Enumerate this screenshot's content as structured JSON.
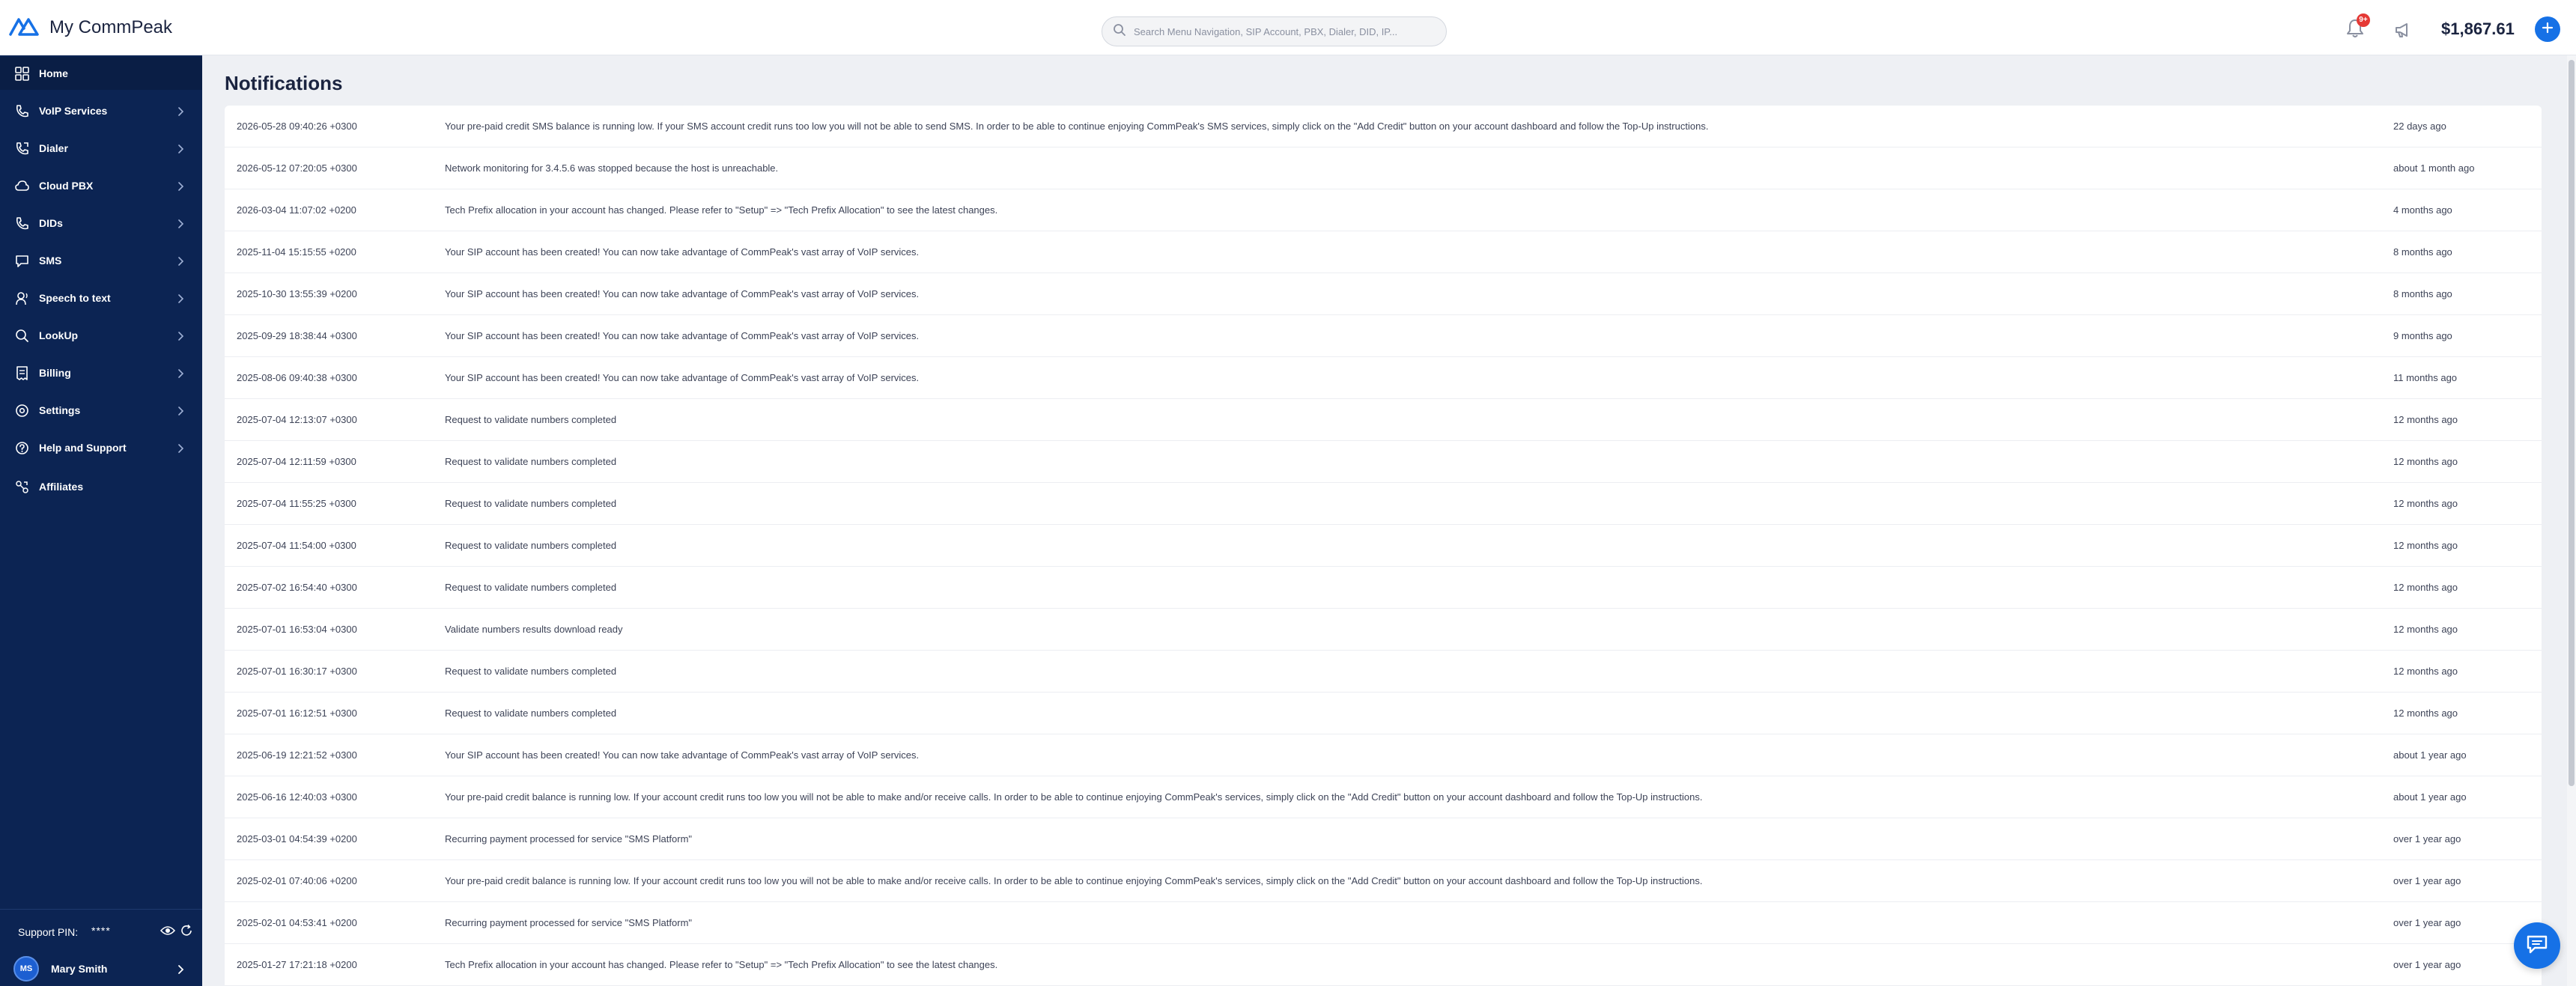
{
  "header": {
    "app_name": "My CommPeak",
    "search_placeholder": "Search Menu Navigation, SIP Account, PBX, Dialer, DID, IP...",
    "notification_count": "9+",
    "balance": "$1,867.61",
    "colors": {
      "brand": "#0c2453",
      "accent": "#1671e6",
      "badge": "#e53935"
    }
  },
  "sidebar": {
    "items": [
      {
        "label": "Home",
        "icon": "home-grid-icon"
      },
      {
        "label": "VoIP Services",
        "icon": "voip-icon"
      },
      {
        "label": "Dialer",
        "icon": "dialer-phone-icon"
      },
      {
        "label": "Cloud PBX",
        "icon": "cloud-icon"
      },
      {
        "label": "DIDs",
        "icon": "did-phone-icon"
      },
      {
        "label": "SMS",
        "icon": "sms-icon"
      },
      {
        "label": "Speech to text",
        "icon": "speech-icon"
      },
      {
        "label": "LookUp",
        "icon": "lookup-icon"
      },
      {
        "label": "Billing",
        "icon": "billing-icon"
      },
      {
        "label": "Settings",
        "icon": "settings-icon"
      },
      {
        "label": "Help and Support",
        "icon": "help-icon"
      },
      {
        "label": "Affiliates",
        "icon": "affiliates-icon"
      }
    ],
    "support_pin_label": "Support PIN:",
    "support_pin_value": "****",
    "user": {
      "initials": "MS",
      "name": "Mary Smith"
    }
  },
  "main": {
    "title": "Notifications",
    "notifications": [
      {
        "date": "2026-05-28 09:40:26 +0300",
        "message": "Your pre-paid credit SMS balance is running low. If your SMS account credit runs too low you will not be able to send SMS. In order to be able to continue enjoying CommPeak's SMS services, simply click on the \"Add Credit\" button on your account dashboard and follow the Top-Up instructions.",
        "ago": "22 days ago"
      },
      {
        "date": "2026-05-12 07:20:05 +0300",
        "message": "Network monitoring for 3.4.5.6 was stopped because the host is unreachable.",
        "ago": "about 1 month ago"
      },
      {
        "date": "2026-03-04 11:07:02 +0200",
        "message": "Tech Prefix allocation in your account has changed. Please refer to \"Setup\" => \"Tech Prefix Allocation\" to see the latest changes.",
        "ago": "4 months ago"
      },
      {
        "date": "2025-11-04 15:15:55 +0200",
        "message": "Your SIP account has been created! You can now take advantage of CommPeak's vast array of VoIP services.",
        "ago": "8 months ago"
      },
      {
        "date": "2025-10-30 13:55:39 +0200",
        "message": "Your SIP account has been created! You can now take advantage of CommPeak's vast array of VoIP services.",
        "ago": "8 months ago"
      },
      {
        "date": "2025-09-29 18:38:44 +0300",
        "message": "Your SIP account has been created! You can now take advantage of CommPeak's vast array of VoIP services.",
        "ago": "9 months ago"
      },
      {
        "date": "2025-08-06 09:40:38 +0300",
        "message": "Your SIP account has been created! You can now take advantage of CommPeak's vast array of VoIP services.",
        "ago": "11 months ago"
      },
      {
        "date": "2025-07-04 12:13:07 +0300",
        "message": "Request to validate numbers completed",
        "ago": "12 months ago"
      },
      {
        "date": "2025-07-04 12:11:59 +0300",
        "message": "Request to validate numbers completed",
        "ago": "12 months ago"
      },
      {
        "date": "2025-07-04 11:55:25 +0300",
        "message": "Request to validate numbers completed",
        "ago": "12 months ago"
      },
      {
        "date": "2025-07-04 11:54:00 +0300",
        "message": "Request to validate numbers completed",
        "ago": "12 months ago"
      },
      {
        "date": "2025-07-02 16:54:40 +0300",
        "message": "Request to validate numbers completed",
        "ago": "12 months ago"
      },
      {
        "date": "2025-07-01 16:53:04 +0300",
        "message": "Validate numbers results download ready",
        "ago": "12 months ago"
      },
      {
        "date": "2025-07-01 16:30:17 +0300",
        "message": "Request to validate numbers completed",
        "ago": "12 months ago"
      },
      {
        "date": "2025-07-01 16:12:51 +0300",
        "message": "Request to validate numbers completed",
        "ago": "12 months ago"
      },
      {
        "date": "2025-06-19 12:21:52 +0300",
        "message": "Your SIP account has been created! You can now take advantage of CommPeak's vast array of VoIP services.",
        "ago": "about 1 year ago"
      },
      {
        "date": "2025-06-16 12:40:03 +0300",
        "message": "Your pre-paid credit balance is running low. If your account credit runs too low you will not be able to make and/or receive calls. In order to be able to continue enjoying CommPeak's services, simply click on the \"Add Credit\" button on your account dashboard and follow the Top-Up instructions.",
        "ago": "about 1 year ago"
      },
      {
        "date": "2025-03-01 04:54:39 +0200",
        "message": "Recurring payment processed for service \"SMS Platform\"",
        "ago": "over 1 year ago"
      },
      {
        "date": "2025-02-01 07:40:06 +0200",
        "message": "Your pre-paid credit balance is running low. If your account credit runs too low you will not be able to make and/or receive calls. In order to be able to continue enjoying CommPeak's services, simply click on the \"Add Credit\" button on your account dashboard and follow the Top-Up instructions.",
        "ago": "over 1 year ago"
      },
      {
        "date": "2025-02-01 04:53:41 +0200",
        "message": "Recurring payment processed for service \"SMS Platform\"",
        "ago": "over 1 year ago"
      },
      {
        "date": "2025-01-27 17:21:18 +0200",
        "message": "Tech Prefix allocation in your account has changed. Please refer to \"Setup\" => \"Tech Prefix Allocation\" to see the latest changes.",
        "ago": "over 1 year ago"
      }
    ]
  }
}
